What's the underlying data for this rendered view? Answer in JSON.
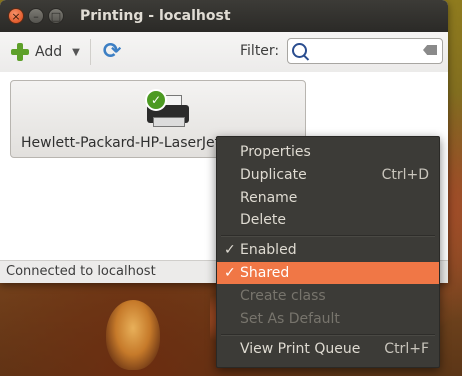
{
  "window": {
    "title": "Printing - localhost",
    "buttons": {
      "close": "×",
      "minimize": "–",
      "maximize": "□"
    }
  },
  "toolbar": {
    "add_label": "Add",
    "dropdown_glyph": "▼",
    "refresh_glyph": "⟳",
    "filter_label": "Filter:",
    "filter_value": "",
    "icons": [
      "plus-icon",
      "refresh-icon",
      "search-icon",
      "clear-icon"
    ]
  },
  "printers": [
    {
      "name": "Hewlett-Packard-HP-LaserJet",
      "default": true
    }
  ],
  "status": {
    "text": "Connected to localhost"
  },
  "context_menu": {
    "items": [
      {
        "label": "Properties",
        "shortcut": ""
      },
      {
        "label": "Duplicate",
        "shortcut": "Ctrl+D"
      },
      {
        "label": "Rename",
        "shortcut": ""
      },
      {
        "label": "Delete",
        "shortcut": ""
      },
      {
        "label": "Enabled",
        "checked": true
      },
      {
        "label": "Shared",
        "checked": true,
        "highlighted": true
      },
      {
        "label": "Create class",
        "disabled": true
      },
      {
        "label": "Set As Default",
        "disabled": true
      },
      {
        "label": "View Print Queue",
        "shortcut": "Ctrl+F"
      }
    ],
    "check_glyph": "✓",
    "highlight_color": "#f07746"
  }
}
